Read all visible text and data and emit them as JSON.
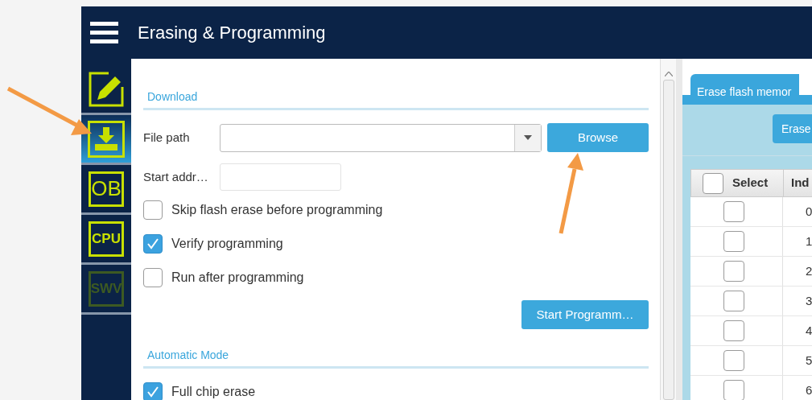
{
  "window": {
    "title": "Erasing & Programming"
  },
  "sidebar": {
    "items": [
      {
        "kind": "pencil",
        "selected": false,
        "disabled": false
      },
      {
        "kind": "download",
        "selected": true,
        "disabled": false
      },
      {
        "kind": "text",
        "label": "OB",
        "selected": false,
        "disabled": false
      },
      {
        "kind": "text",
        "label": "CPU",
        "selected": false,
        "disabled": false
      },
      {
        "kind": "text",
        "label": "SWV",
        "selected": false,
        "disabled": true
      }
    ]
  },
  "download": {
    "title": "Download",
    "file_path_label": "File path",
    "browse_button": "Browse",
    "start_address_label": "Start addr…",
    "options": [
      {
        "label": "Skip flash erase before programming",
        "checked": false
      },
      {
        "label": "Verify programming",
        "checked": true
      },
      {
        "label": "Run after programming",
        "checked": false
      }
    ],
    "start_button": "Start Programm…"
  },
  "automatic_mode": {
    "title": "Automatic Mode",
    "options": [
      {
        "label": "Full chip erase",
        "checked": true
      }
    ]
  },
  "erase_panel": {
    "tab": {
      "label": "Erase flash memor",
      "selected": true
    },
    "erase_button": "Erase",
    "table": {
      "columns": [
        "Select",
        "Ind"
      ],
      "header_checked": false,
      "rows": [
        {
          "checked": false,
          "index": "0"
        },
        {
          "checked": false,
          "index": "1"
        },
        {
          "checked": false,
          "index": "2"
        },
        {
          "checked": false,
          "index": "3"
        },
        {
          "checked": false,
          "index": "4"
        },
        {
          "checked": false,
          "index": "5"
        },
        {
          "checked": false,
          "index": "6"
        }
      ]
    }
  }
}
